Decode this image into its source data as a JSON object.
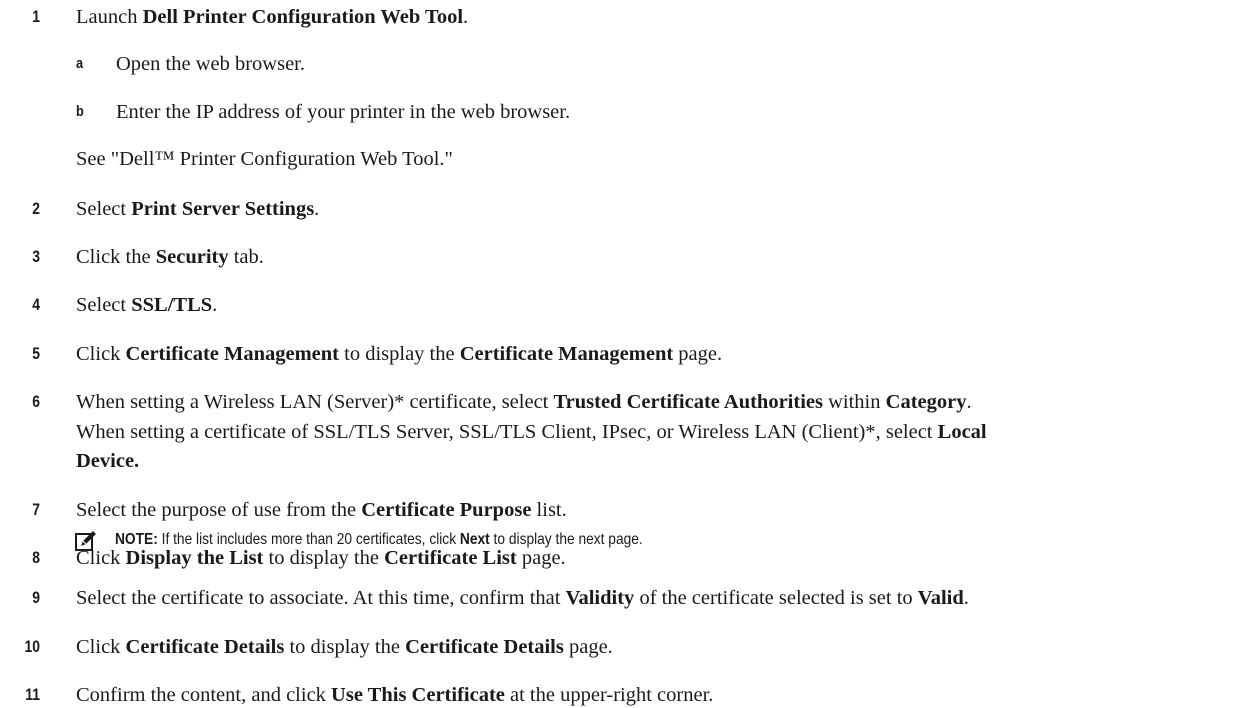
{
  "steps": [
    {
      "num": "1",
      "parts": [
        [
          "Launch ",
          0
        ],
        [
          "Dell Printer Configuration Web Tool",
          1
        ],
        [
          ".",
          0
        ]
      ]
    },
    {
      "num": "a",
      "parts": [
        [
          "Open the web browser.",
          0
        ]
      ]
    },
    {
      "num": "b",
      "parts": [
        [
          "Enter the IP address of your printer in the web browser.",
          0
        ]
      ]
    },
    {
      "num": "",
      "parts": [
        [
          "See \"Dell™ Printer Configuration Web Tool.\"",
          0
        ]
      ]
    },
    {
      "num": "2",
      "parts": [
        [
          "Select ",
          0
        ],
        [
          "Print Server Settings",
          1
        ],
        [
          ".",
          0
        ]
      ]
    },
    {
      "num": "3",
      "parts": [
        [
          "Click the ",
          0
        ],
        [
          "Security",
          1
        ],
        [
          " tab.",
          0
        ]
      ]
    },
    {
      "num": "4",
      "parts": [
        [
          "Select ",
          0
        ],
        [
          "SSL/TLS",
          1
        ],
        [
          ".",
          0
        ]
      ]
    },
    {
      "num": "5",
      "parts": [
        [
          "Click ",
          0
        ],
        [
          "Certificate Management",
          1
        ],
        [
          " to display the ",
          0
        ],
        [
          "Certificate Management",
          1
        ],
        [
          " page.",
          0
        ]
      ]
    },
    {
      "num": "6",
      "parts": [
        [
          "When setting a Wireless LAN (Server)* certificate, select ",
          0
        ],
        [
          "Trusted Certificate Authorities",
          1
        ],
        [
          " within ",
          0
        ],
        [
          "Category",
          1
        ],
        [
          ".",
          0
        ]
      ]
    },
    {
      "num": "",
      "parts": [
        [
          "When setting a certificate of SSL/TLS Server, SSL/TLS Client, IPsec, or Wireless LAN (Client)*, select ",
          0
        ],
        [
          "Local",
          1
        ]
      ]
    },
    {
      "num": "",
      "parts": [
        [
          "Device.",
          1
        ]
      ]
    },
    {
      "num": "7",
      "parts": [
        [
          "Select the purpose of use from the ",
          0
        ],
        [
          "Certificate Purpose",
          1
        ],
        [
          " list.",
          0
        ]
      ]
    },
    {
      "num": "8",
      "parts": [
        [
          "Click ",
          0
        ],
        [
          "Display the List",
          1
        ],
        [
          " to display the ",
          0
        ],
        [
          "Certificate List",
          1
        ],
        [
          " page.",
          0
        ]
      ]
    },
    {
      "num": "9",
      "parts": [
        [
          "Select the certificate to associate. At this time, confirm that ",
          0
        ],
        [
          "Validity",
          1
        ],
        [
          " of the certificate selected is set to ",
          0
        ],
        [
          "Valid",
          1
        ],
        [
          ".",
          0
        ]
      ]
    },
    {
      "num": "10",
      "parts": [
        [
          "Click ",
          0
        ],
        [
          "Certificate Details",
          1
        ],
        [
          " to display the ",
          0
        ],
        [
          "Certificate Details",
          1
        ],
        [
          " page.",
          0
        ]
      ]
    },
    {
      "num": "11",
      "parts": [
        [
          "Confirm the content, and click ",
          0
        ],
        [
          "Use This Certificate",
          1
        ],
        [
          " at the upper-right corner.",
          0
        ]
      ]
    }
  ],
  "note": {
    "icon": "pencil-note-icon",
    "parts": [
      [
        "NOTE:",
        1
      ],
      [
        " If the list includes more than 20 certificates, click ",
        0
      ],
      [
        "Next",
        1
      ],
      [
        " to display the next page.",
        0
      ]
    ]
  }
}
